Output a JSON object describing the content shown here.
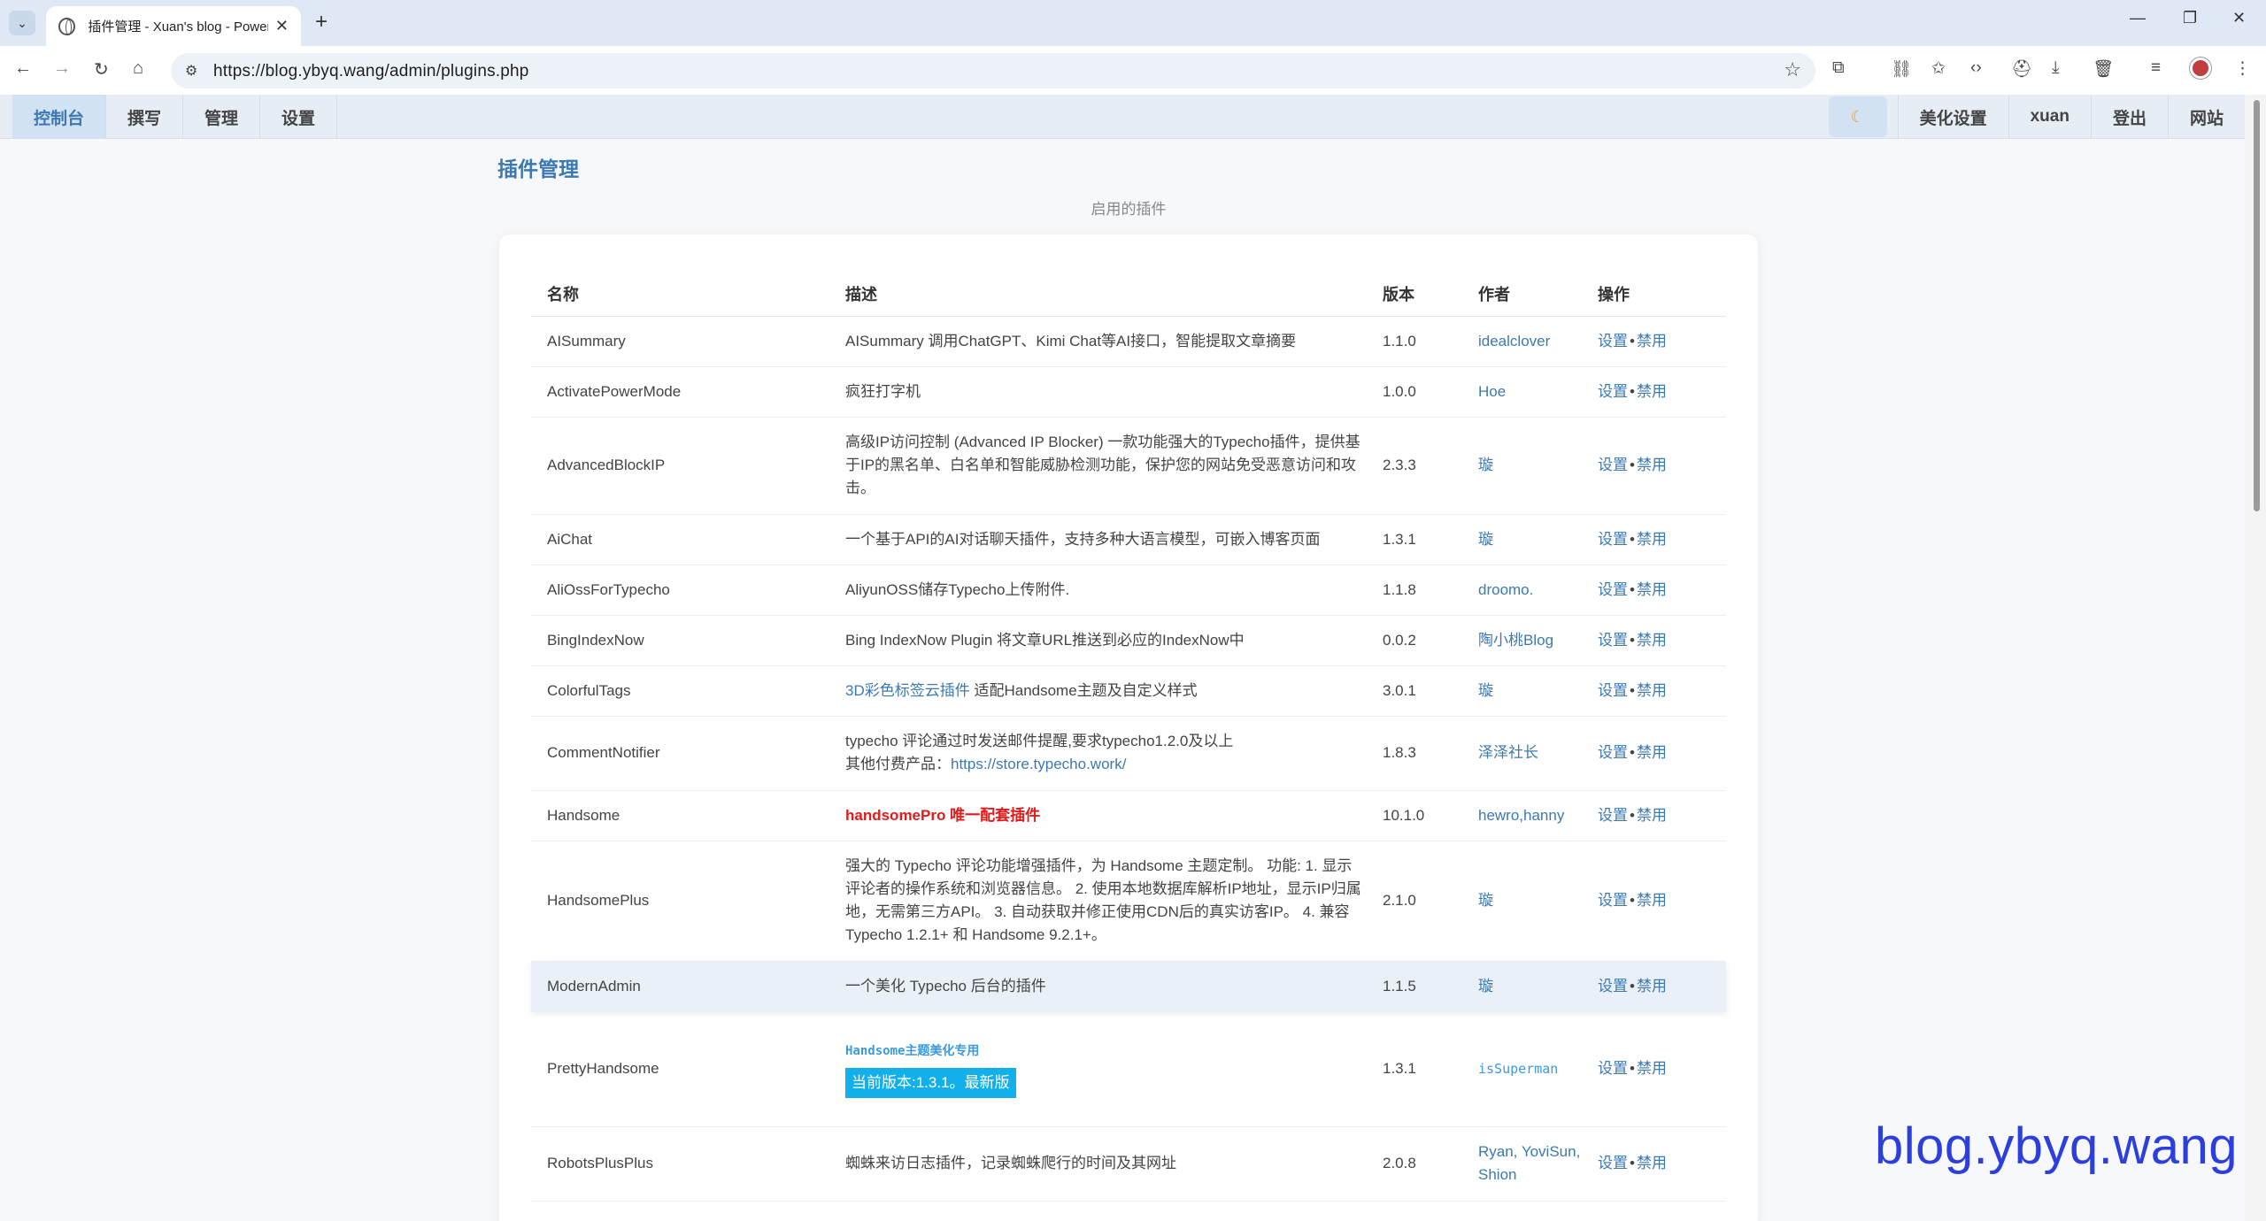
{
  "browser": {
    "tab_title": "插件管理 - Xuan's blog - Powered by Typecho",
    "url": "https://blog.ybyq.wang/admin/plugins.php"
  },
  "admin_menu": {
    "left": [
      "控制台",
      "撰写",
      "管理",
      "设置"
    ],
    "right": [
      "美化设置",
      "xuan",
      "登出",
      "网站"
    ]
  },
  "page": {
    "title": "插件管理",
    "subtitle": "启用的插件"
  },
  "table": {
    "headers": [
      "名称",
      "描述",
      "版本",
      "作者",
      "操作"
    ],
    "action_settings": "设置",
    "action_disable": "禁用",
    "rows": [
      {
        "name": "AISummary",
        "desc": "AISummary 调用ChatGPT、Kimi Chat等AI接口，智能提取文章摘要",
        "version": "1.1.0",
        "author": "idealclover"
      },
      {
        "name": "ActivatePowerMode",
        "desc": "疯狂打字机",
        "version": "1.0.0",
        "author": "Hoe"
      },
      {
        "name": "AdvancedBlockIP",
        "desc": "高级IP访问控制 (Advanced IP Blocker) 一款功能强大的Typecho插件，提供基于IP的黑名单、白名单和智能威胁检测功能，保护您的网站免受恶意访问和攻击。",
        "version": "2.3.3",
        "author": "璇"
      },
      {
        "name": "AiChat",
        "desc": "一个基于API的AI对话聊天插件，支持多种大语言模型，可嵌入博客页面",
        "version": "1.3.1",
        "author": "璇"
      },
      {
        "name": "AliOssForTypecho",
        "desc": "AliyunOSS储存Typecho上传附件.",
        "version": "1.1.8",
        "author": "droomo."
      },
      {
        "name": "BingIndexNow",
        "desc": "Bing IndexNow Plugin 将文章URL推送到必应的IndexNow中",
        "version": "0.0.2",
        "author": "陶小桃Blog"
      },
      {
        "name": "ColorfulTags",
        "desc_link": "3D彩色标签云插件",
        "desc": " 适配Handsome主题及自定义样式",
        "version": "3.0.1",
        "author": "璇"
      },
      {
        "name": "CommentNotifier",
        "desc": "typecho 评论通过时发送邮件提醒,要求typecho1.2.0及以上",
        "desc_line2": "其他付费产品：",
        "desc_link": "https://store.typecho.work/",
        "version": "1.8.3",
        "author": "泽泽社长"
      },
      {
        "name": "Handsome",
        "desc": "handsomePro 唯一配套插件",
        "version": "10.1.0",
        "author": "hewro,hanny"
      },
      {
        "name": "HandsomePlus",
        "desc": "强大的 Typecho 评论功能增强插件，为 Handsome 主题定制。 功能: 1. 显示评论者的操作系统和浏览器信息。 2. 使用本地数据库解析IP地址，显示IP归属地，无需第三方API。 3. 自动获取并修正使用CDN后的真实访客IP。 4. 兼容 Typecho 1.2.1+ 和 Handsome 9.2.1+。",
        "version": "2.1.0",
        "author": "璇"
      },
      {
        "name": "ModernAdmin",
        "desc": "一个美化 Typecho 后台的插件",
        "version": "1.1.5",
        "author": "璇"
      },
      {
        "name": "PrettyHandsome",
        "desc": "Handsome主题美化专用",
        "badge": "当前版本:1.3.1。最新版",
        "version": "1.3.1",
        "author": "isSuperman"
      },
      {
        "name": "RobotsPlusPlus",
        "desc": "蜘蛛来访日志插件，记录蜘蛛爬行的时间及其网址",
        "version": "2.0.8",
        "author": "Ryan, YoviSun, Shion"
      }
    ]
  },
  "watermark": "blog.ybyq.wang",
  "colors": {
    "accent": "#3c79b1",
    "badge": "#12b0ea",
    "danger": "#e01b1b",
    "watermark": "#2c3edb"
  }
}
